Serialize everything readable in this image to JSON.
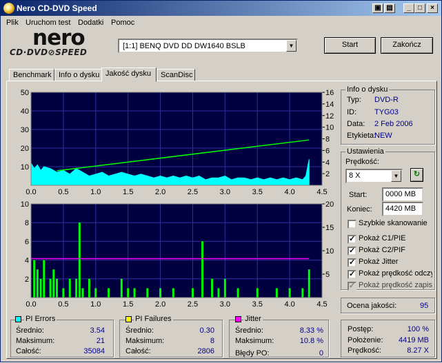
{
  "title": "Nero CD-DVD Speed",
  "menu": [
    "Plik",
    "Uruchom test",
    "Dodatki",
    "Pomoc"
  ],
  "logo": {
    "nero": "nero",
    "cdspeed": "CD·DVD⊘SPEED"
  },
  "drive": "[1:1]  BENQ DVD DD DW1640 BSLB",
  "buttons": {
    "start": "Start",
    "end": "Zakończ"
  },
  "tabs": [
    "Benchmark",
    "Info o dysku",
    "Jakość dysku",
    "ScanDisc"
  ],
  "active_tab": 2,
  "disc_info": {
    "title": "Info o dysku",
    "type_label": "Typ:",
    "type": "DVD-R",
    "id_label": "ID:",
    "id": "TYG03",
    "date_label": "Data:",
    "date": "2 Feb 2006",
    "etykieta_label": "Etykieta:",
    "etykieta": "NEW"
  },
  "settings": {
    "title": "Ustawienia",
    "speed_label": "Prędkość:",
    "speed": "8 X",
    "start_label": "Start:",
    "start": "0000 MB",
    "end_label": "Koniec:",
    "end": "4420 MB",
    "checks": [
      {
        "label": "Szybkie skanowanie",
        "checked": false,
        "disabled": false
      },
      {
        "label": "Pokaż C1/PIE",
        "checked": true,
        "disabled": false
      },
      {
        "label": "Pokaż C2/PIF",
        "checked": true,
        "disabled": false
      },
      {
        "label": "Pokaż Jitter",
        "checked": true,
        "disabled": false
      },
      {
        "label": "Pokaż prędkość odczytu",
        "checked": true,
        "disabled": false
      },
      {
        "label": "Pokaż prędkość zapisu",
        "checked": true,
        "disabled": true
      }
    ]
  },
  "quality": {
    "label": "Ocena jakości:",
    "value": "95"
  },
  "pi_errors": {
    "title": "PI Errors",
    "color": "#00ffff",
    "avg_label": "Średnio:",
    "avg": "3.54",
    "max_label": "Maksimum:",
    "max": "21",
    "total_label": "Całość:",
    "total": "35084"
  },
  "pi_failures": {
    "title": "PI Failures",
    "color": "#ffff00",
    "avg_label": "Średnio:",
    "avg": "0.30",
    "max_label": "Maksimum:",
    "max": "8",
    "total_label": "Całość:",
    "total": "2806"
  },
  "jitter": {
    "title": "Jitter",
    "color": "#ff00ff",
    "avg_label": "Średnio:",
    "avg": "8.33 %",
    "max_label": "Maksimum:",
    "max": "10.8 %",
    "po_label": "Błędy PO:",
    "po": "0"
  },
  "progress": {
    "postep_label": "Postęp:",
    "postep": "100 %",
    "polozenie_label": "Położenie:",
    "polozenie": "4419 MB",
    "predkosc_label": "Prędkość:",
    "predkosc": "8.27 X"
  },
  "chart_data": [
    {
      "type": "area",
      "name": "PI Errors",
      "x_ticks": [
        "0.0",
        "0.5",
        "1.0",
        "1.5",
        "2.0",
        "2.5",
        "3.0",
        "3.5",
        "4.0",
        "4.5"
      ],
      "y_left_ticks": [
        "50",
        "40",
        "30",
        "20",
        "10"
      ],
      "y_right_ticks": [
        "16",
        "14",
        "12",
        "10",
        "8",
        "6",
        "4",
        "2"
      ],
      "xlim": [
        0,
        4.5
      ],
      "ylim_left": [
        0,
        50
      ],
      "ylim_right": [
        0,
        16
      ],
      "series": [
        {
          "color": "#00ffff",
          "x": [
            0.0,
            0.05,
            0.1,
            0.15,
            0.2,
            0.3,
            0.4,
            0.5,
            0.6,
            0.7,
            0.8,
            0.9,
            1.0,
            1.1,
            1.2,
            1.3,
            1.4,
            1.5,
            1.6,
            1.7,
            1.8,
            1.9,
            2.0,
            2.1,
            2.2,
            2.3,
            2.4,
            2.5,
            2.6,
            2.7,
            2.8,
            2.9,
            3.0,
            3.1,
            3.2,
            3.3,
            3.4,
            3.5,
            3.6,
            3.7,
            3.8,
            3.9,
            4.0,
            4.1,
            4.2,
            4.25,
            4.3
          ],
          "values": [
            12,
            9,
            11,
            8,
            10,
            9,
            7,
            8,
            6,
            9,
            7,
            5,
            6,
            7,
            5,
            6,
            7,
            6,
            5,
            6,
            5,
            4,
            5,
            4,
            5,
            4,
            5,
            4,
            5,
            3,
            4,
            4,
            5,
            3,
            4,
            4,
            3,
            4,
            3,
            4,
            3,
            4,
            3,
            4,
            3,
            5,
            14
          ]
        },
        {
          "color": "#00ff00",
          "axis": "right",
          "x": [
            0.4,
            4.3
          ],
          "values": [
            2.5,
            7.8
          ]
        }
      ]
    },
    {
      "type": "bar",
      "name": "PI Failures / Jitter",
      "x_ticks": [
        "0.0",
        "0.5",
        "1.0",
        "1.5",
        "2.0",
        "2.5",
        "3.0",
        "3.5",
        "4.0",
        "4.5"
      ],
      "y_left_ticks": [
        "10",
        "8",
        "6",
        "4",
        "2"
      ],
      "y_right_ticks": [
        "20",
        "15",
        "10",
        "5"
      ],
      "xlim": [
        0,
        4.5
      ],
      "ylim_left": [
        0,
        10
      ],
      "ylim_right": [
        0,
        20
      ],
      "series": [
        {
          "color": "#00ff00",
          "x": [
            0.05,
            0.1,
            0.15,
            0.2,
            0.3,
            0.35,
            0.4,
            0.5,
            0.6,
            0.7,
            0.75,
            0.8,
            0.9,
            1.0,
            1.2,
            1.4,
            1.5,
            1.6,
            1.8,
            2.0,
            2.2,
            2.5,
            2.65,
            2.8,
            2.9,
            3.0,
            3.2,
            3.5,
            3.8,
            4.0,
            4.2,
            4.3
          ],
          "values": [
            4,
            3,
            2,
            4,
            2,
            3,
            2,
            1,
            2,
            2,
            8,
            1,
            2,
            1,
            1,
            2,
            1,
            1,
            1,
            1,
            1,
            1,
            6,
            2,
            1,
            2,
            1,
            1,
            1,
            1,
            1,
            3
          ]
        },
        {
          "color": "#ff00ff",
          "axis": "right",
          "x": [
            0.0,
            4.3
          ],
          "values": [
            8.3,
            8.3
          ]
        }
      ]
    }
  ]
}
